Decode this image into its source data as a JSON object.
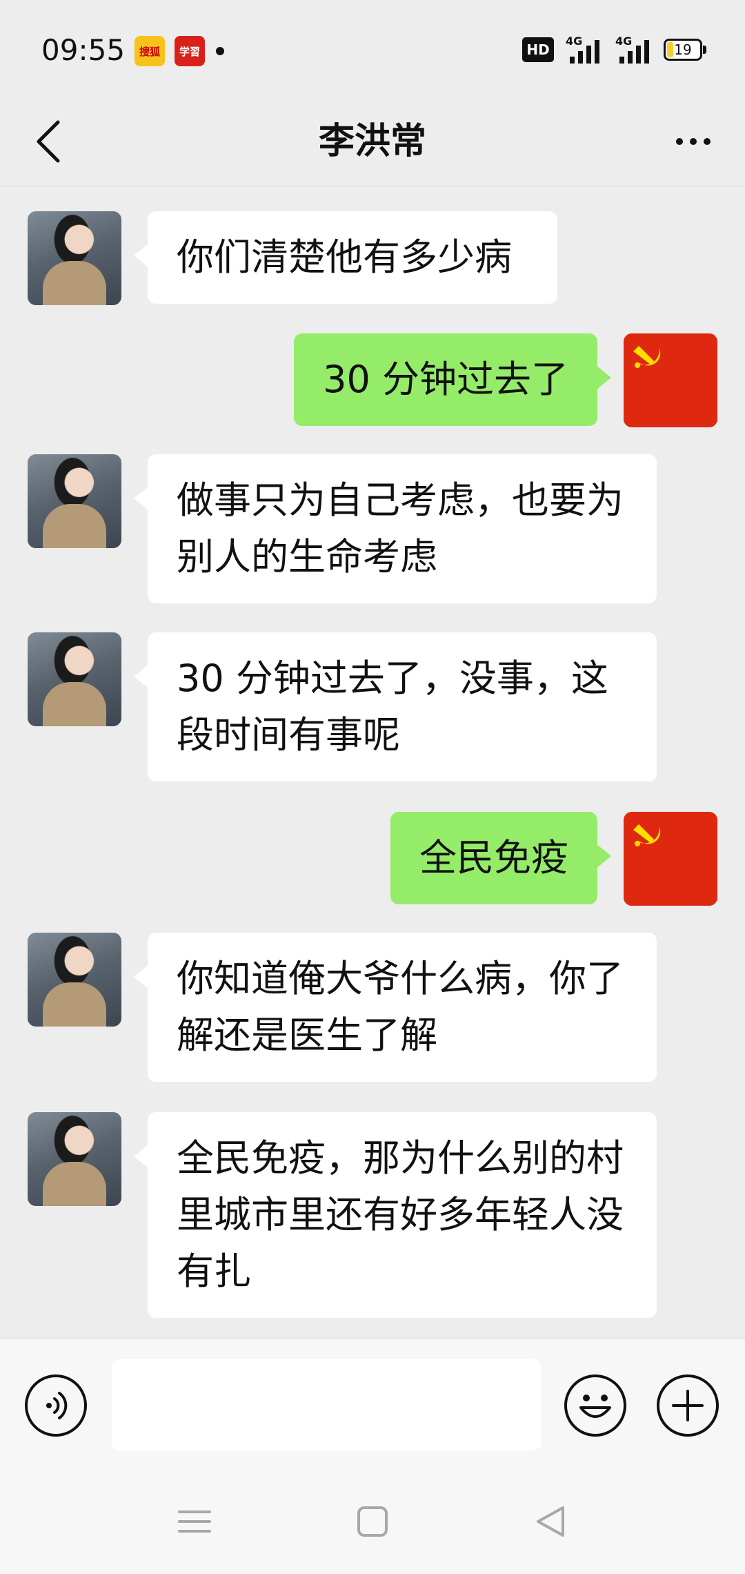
{
  "status_bar": {
    "time": "09:55",
    "notif_sohu": "搜狐",
    "notif_xuexi": "学習",
    "hd_label": "HD",
    "signal_1": "4G",
    "signal_2": "4G",
    "battery": "19",
    "battery_level": 0.19
  },
  "nav": {
    "title": "李洪常"
  },
  "messages": [
    {
      "side": "left",
      "avatar": "person-photo-avatar",
      "text": "你们清楚他有多少病"
    },
    {
      "side": "right",
      "avatar": "party-flag-avatar",
      "text": "30 分钟过去了"
    },
    {
      "side": "left",
      "avatar": "person-photo-avatar",
      "text": "做事只为自己考虑，也要为别人的生命考虑"
    },
    {
      "side": "left",
      "avatar": "person-photo-avatar",
      "text": "30 分钟过去了，没事，这段时间有事呢"
    },
    {
      "side": "right",
      "avatar": "party-flag-avatar",
      "text": "全民免疫"
    },
    {
      "side": "left",
      "avatar": "person-photo-avatar",
      "text": "你知道俺大爷什么病，你了解还是医生了解"
    },
    {
      "side": "left",
      "avatar": "person-photo-avatar",
      "text": "全民免疫，那为什么别的村里城市里还有好多年轻人没有扎"
    }
  ],
  "input": {
    "value": "",
    "placeholder": ""
  },
  "colors": {
    "background": "#ededed",
    "bubble_self": "#95ec69",
    "bubble_other": "#ffffff",
    "flag_red": "#de2910"
  }
}
